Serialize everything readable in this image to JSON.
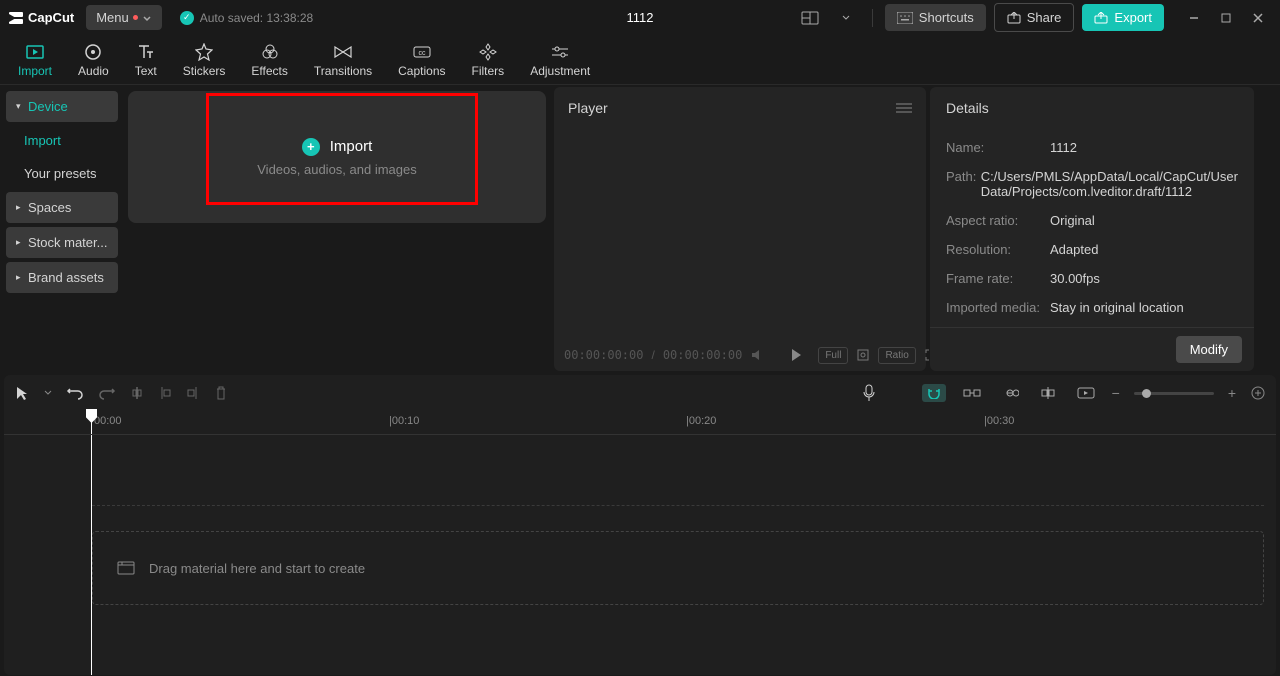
{
  "app_name": "CapCut",
  "menu_label": "Menu",
  "autosave": "Auto saved: 13:38:28",
  "project_title": "1112",
  "shortcuts": "Shortcuts",
  "share": "Share",
  "export": "Export",
  "tabs": {
    "import": "Import",
    "audio": "Audio",
    "text": "Text",
    "stickers": "Stickers",
    "effects": "Effects",
    "transitions": "Transitions",
    "captions": "Captions",
    "filters": "Filters",
    "adjustment": "Adjustment"
  },
  "sidebar": {
    "device": "Device",
    "import": "Import",
    "presets": "Your presets",
    "spaces": "Spaces",
    "stock": "Stock mater...",
    "brand": "Brand assets"
  },
  "import_box": {
    "title": "Import",
    "subtitle": "Videos, audios, and images"
  },
  "player": {
    "title": "Player",
    "tc1": "00:00:00:00",
    "tc_sep": " / ",
    "tc2": "00:00:00:00",
    "full": "Full",
    "ratio": "Ratio"
  },
  "details": {
    "title": "Details",
    "name_l": "Name:",
    "name_v": "1112",
    "path_l": "Path:",
    "path_v": "C:/Users/PMLS/AppData/Local/CapCut/User Data/Projects/com.lveditor.draft/1112",
    "ar_l": "Aspect ratio:",
    "ar_v": "Original",
    "res_l": "Resolution:",
    "res_v": "Adapted",
    "fr_l": "Frame rate:",
    "fr_v": "30.00fps",
    "im_l": "Imported media:",
    "im_v": "Stay in original location",
    "modify": "Modify"
  },
  "timeline": {
    "marks": {
      "m0": "00:00",
      "m1": "|00:10",
      "m2": "|00:20",
      "m3": "|00:30"
    },
    "hint": "Drag material here and start to create"
  }
}
